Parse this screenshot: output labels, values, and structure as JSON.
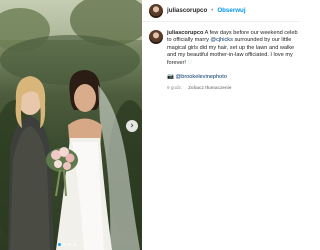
{
  "post": {
    "username": "juliascorupco",
    "separator": "•",
    "follow_label": "Obserwuj",
    "caption": {
      "author": "juliascorupco",
      "line1_rest": "A few days before our weekend celeb",
      "line2_start": "to officially marry ",
      "line2_mention": "@cjhicks",
      "line2_end": " surrounded by our little",
      "line3": "magical girls did my hair, set up the lawn and walke",
      "line4": "and my beautiful mother-in-law officiated. I love my",
      "line5_text": "forever! ",
      "line5_emoji": "♡",
      "photo_credit_emoji": "📷",
      "photo_credit": "@brookelevinephoto"
    },
    "time_ago": "9 godz.",
    "translate_label": "Zobacz tłumaczenie"
  },
  "media": {
    "carousel_dot_count": 4,
    "active_dot": 0,
    "next_icon_glyph": "›"
  },
  "colors": {
    "link": "#0095f6",
    "mention": "#00376b",
    "secondary_text": "#8e8e8e",
    "active_dot": "#1da1f2"
  }
}
